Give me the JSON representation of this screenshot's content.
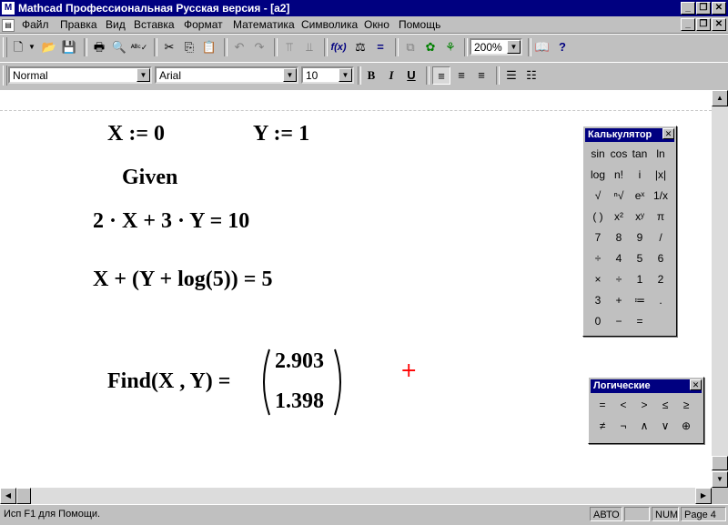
{
  "window": {
    "title": "Mathcad Профессиональная Русская версия - [a2]",
    "app_icon": "mathcad-app-icon"
  },
  "menu": [
    "Файл",
    "Правка",
    "Вид",
    "Вставка",
    "Формат",
    "Математика",
    "Символика",
    "Окно",
    "Помощь"
  ],
  "toolbar": {
    "zoom": "200%"
  },
  "format_bar": {
    "style": "Normal",
    "font": "Arial",
    "size": "10",
    "bold": "B",
    "italic": "I",
    "underline": "U"
  },
  "document": {
    "line1_x": "X := 0",
    "line1_y": "Y := 1",
    "given": "Given",
    "eq1": "2 · X + 3 · Y = 10",
    "eq2": "X + (Y + log(5)) = 5",
    "find_lhs": "Find(X , Y) =",
    "result_x": "2.903",
    "result_y": "1.398",
    "cursor": "+"
  },
  "calculator": {
    "title": "Калькулятор",
    "close": "✕",
    "buttons": [
      "sin",
      "cos",
      "tan",
      "ln",
      "log",
      "n!",
      "i",
      "|x|",
      "√",
      "ⁿ√",
      "eˣ",
      "1/x",
      "( )",
      "x²",
      "xʸ",
      "π",
      "7",
      "8",
      "9",
      "/",
      "÷",
      "4",
      "5",
      "6",
      "×",
      "÷",
      "1",
      "2",
      "3",
      "+",
      "≔",
      ".",
      "0",
      "−",
      "="
    ]
  },
  "logic": {
    "title": "Логические",
    "close": "✕",
    "buttons": [
      "=",
      "<",
      ">",
      "≤",
      "≥",
      "≠",
      "¬",
      "∧",
      "∨",
      "⊕"
    ]
  },
  "status": {
    "help": "Исп F1 для Помощи.",
    "auto": "АВТО",
    "num": "NUM",
    "page": "Page 4"
  },
  "colors": {
    "titlebar": "#000080",
    "cursor": "#ff0000"
  }
}
